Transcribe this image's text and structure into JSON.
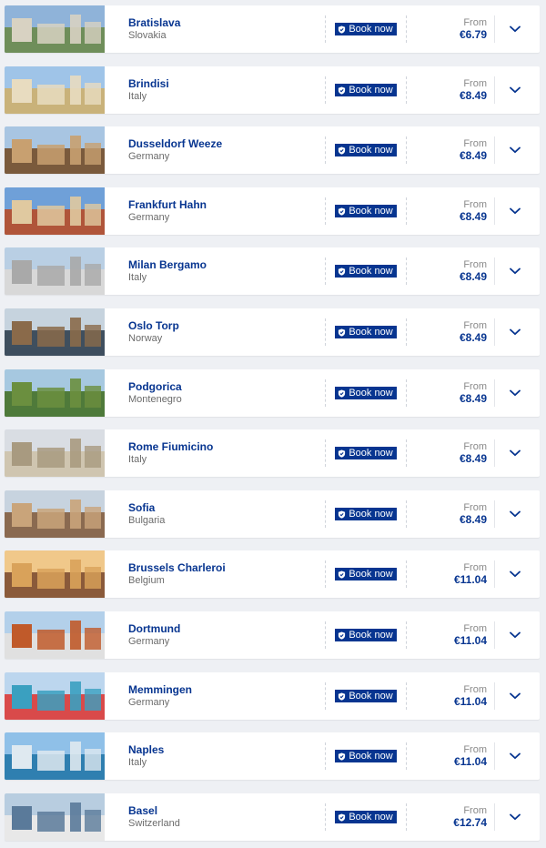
{
  "colors": {
    "brand": "#073590",
    "background": "#eef0f4",
    "muted": "#6b6b6b"
  },
  "book_label": "Book now",
  "from_label": "From",
  "destinations": [
    {
      "city": "Bratislava",
      "country": "Slovakia",
      "price": "€6.79",
      "image": "castle-hill-photo"
    },
    {
      "city": "Brindisi",
      "country": "Italy",
      "price": "€8.49",
      "image": "waterfront-palazzo-photo"
    },
    {
      "city": "Dusseldorf Weeze",
      "country": "Germany",
      "price": "€8.49",
      "image": "ferris-wheel-church-photo"
    },
    {
      "city": "Frankfurt Hahn",
      "country": "Germany",
      "price": "€8.49",
      "image": "timber-houses-photo"
    },
    {
      "city": "Milan Bergamo",
      "country": "Italy",
      "price": "€8.49",
      "image": "duomo-photo"
    },
    {
      "city": "Oslo Torp",
      "country": "Norway",
      "price": "€8.49",
      "image": "harbour-skyline-photo"
    },
    {
      "city": "Podgorica",
      "country": "Montenegro",
      "price": "€8.49",
      "image": "river-greenery-photo"
    },
    {
      "city": "Rome Fiumicino",
      "country": "Italy",
      "price": "€8.49",
      "image": "trevi-fountain-photo"
    },
    {
      "city": "Sofia",
      "country": "Bulgaria",
      "price": "€8.49",
      "image": "fountain-square-photo"
    },
    {
      "city": "Brussels Charleroi",
      "country": "Belgium",
      "price": "€11.04",
      "image": "grand-place-photo"
    },
    {
      "city": "Dortmund",
      "country": "Germany",
      "price": "€11.04",
      "image": "half-timbered-house-photo"
    },
    {
      "city": "Memmingen",
      "country": "Germany",
      "price": "€11.04",
      "image": "colourful-facades-photo"
    },
    {
      "city": "Naples",
      "country": "Italy",
      "price": "€11.04",
      "image": "bay-vesuvius-photo"
    },
    {
      "city": "Basel",
      "country": "Switzerland",
      "price": "€12.74",
      "image": "riverside-town-photo"
    }
  ]
}
